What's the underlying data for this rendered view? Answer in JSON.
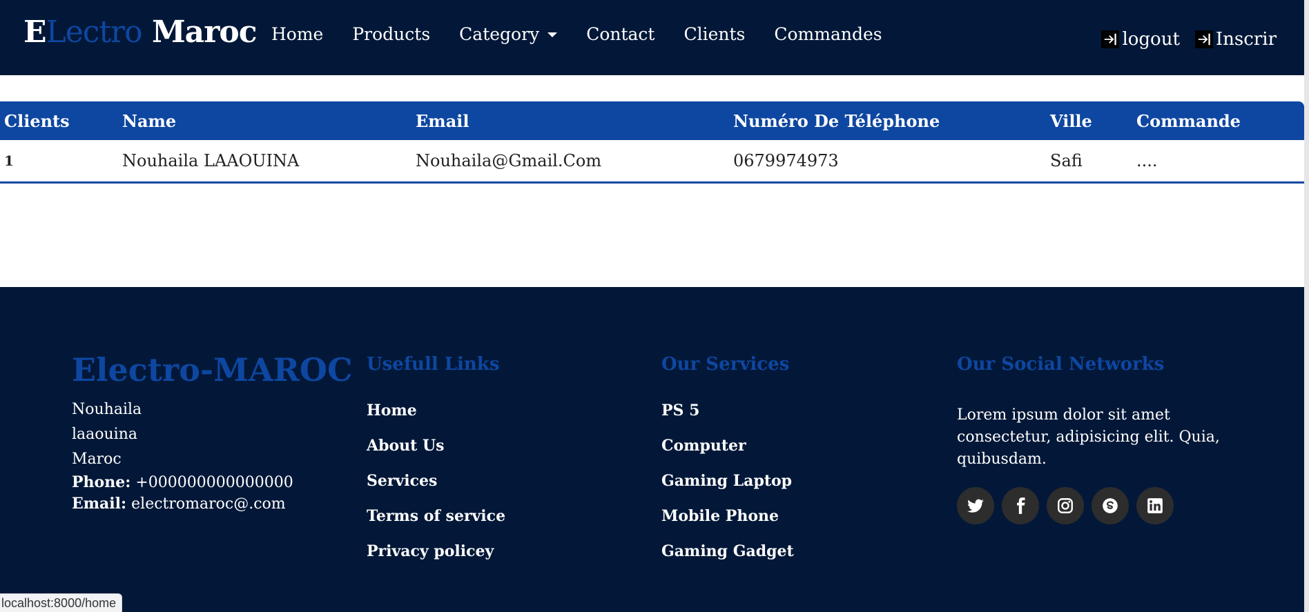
{
  "brand": {
    "first": "E",
    "middle": "Lectro",
    "last": " Maroc"
  },
  "nav": {
    "home": "Home",
    "products": "Products",
    "category": "Category",
    "contact": "Contact",
    "clients": "Clients",
    "commandes": "Commandes"
  },
  "auth": {
    "logout": "logout",
    "inscrir": "Inscrir"
  },
  "table": {
    "headers": [
      "Clients",
      "Name",
      "Email",
      "Numéro De Téléphone",
      "Ville",
      "Commande"
    ],
    "rows": [
      [
        "1",
        "Nouhaila LAAOUINA",
        "Nouhaila@Gmail.Com",
        "0679974973",
        "Safi",
        "...."
      ]
    ]
  },
  "footer": {
    "brand": "Electro-MAROC",
    "address": [
      "Nouhaila",
      "laaouina",
      "Maroc"
    ],
    "phone_label": "Phone:",
    "phone_value": "+000000000000000",
    "email_label": "Email:",
    "email_value": "electromaroc@.com",
    "links_heading": "Usefull Links",
    "links": [
      "Home",
      "About Us",
      "Services",
      "Terms of service",
      "Privacy policey"
    ],
    "services_heading": "Our Services",
    "services": [
      "PS 5",
      "Computer",
      "Gaming Laptop",
      "Mobile Phone",
      "Gaming Gadget"
    ],
    "social_heading": "Our Social Networks",
    "social_text": "Lorem ipsum dolor sit amet consectetur, adipisicing elit. Quia, quibusdam.",
    "social_icons": [
      "twitter-icon",
      "facebook-icon",
      "instagram-icon",
      "skype-icon",
      "linkedin-icon"
    ]
  },
  "status_bar": {
    "url": "localhost:8000/home"
  },
  "colors": {
    "navy": "#031838",
    "accent": "#0e47a1",
    "white": "#ffffff",
    "social_bg": "#2d2d2d"
  }
}
